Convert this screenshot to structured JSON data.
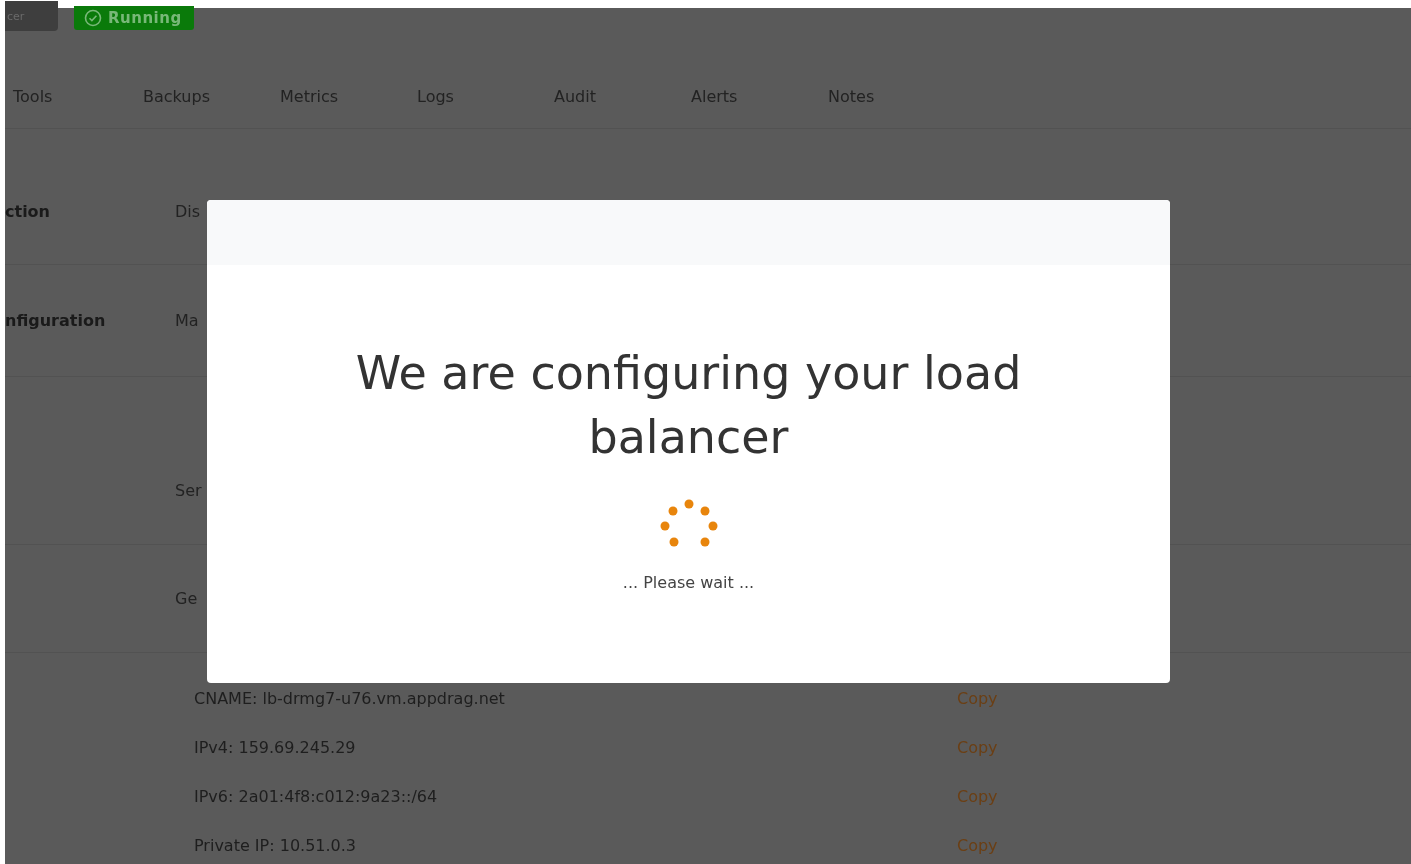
{
  "header": {
    "button": "cer",
    "status_badge": "Running"
  },
  "tabs": [
    "Tools",
    "Backups",
    "Metrics",
    "Logs",
    "Audit",
    "Alerts",
    "Notes"
  ],
  "rows": [
    {
      "label": "ction",
      "value": "Dis"
    },
    {
      "label": "nfiguration",
      "value": "Ma"
    },
    {
      "value": "Ser"
    },
    {
      "value": "Ge"
    }
  ],
  "endpoints": [
    {
      "text": "CNAME: lb-drmg7-u76.vm.appdrag.net",
      "action": "Copy"
    },
    {
      "text": "IPv4: 159.69.245.29",
      "action": "Copy"
    },
    {
      "text": "IPv6: 2a01:4f8:c012:9a23::/64",
      "action": "Copy"
    },
    {
      "text": "Private IP: 10.51.0.3",
      "action": "Copy"
    }
  ],
  "modal": {
    "title": "We are configuring your load balancer",
    "message": "... Please wait ..."
  }
}
